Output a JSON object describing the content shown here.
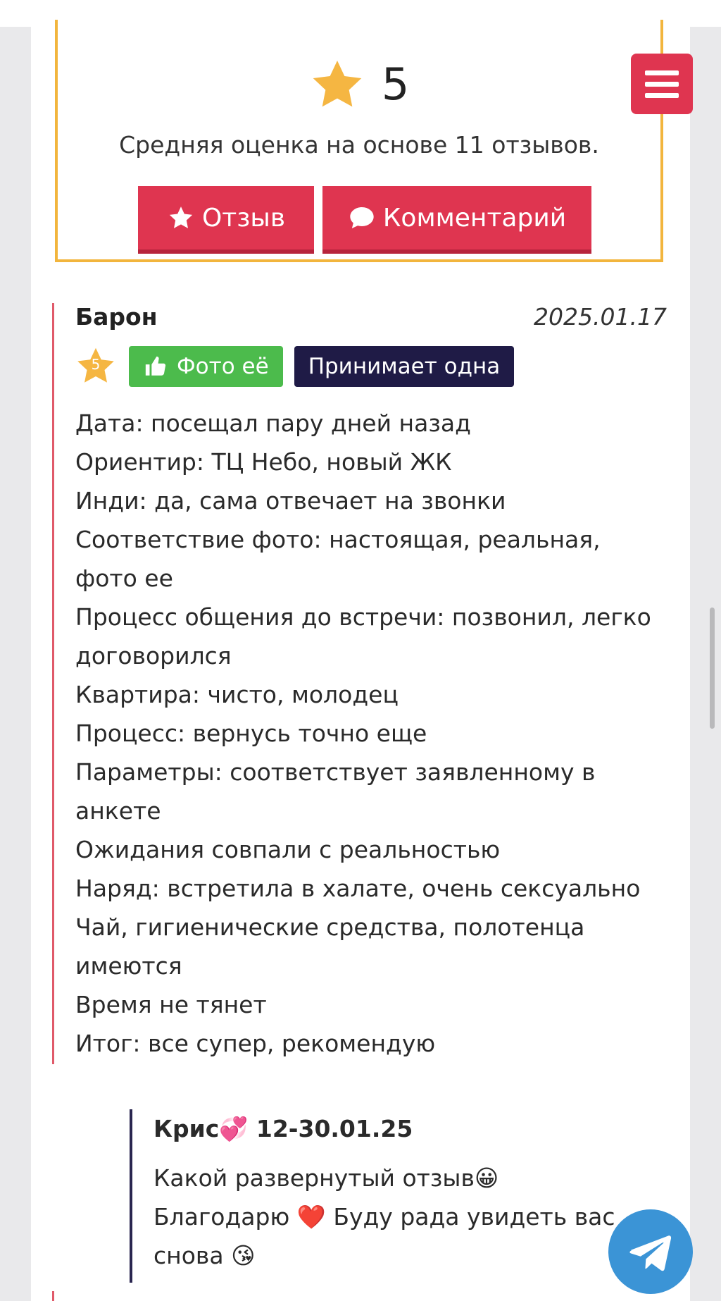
{
  "rating": {
    "value": "5",
    "summary": "Средняя оценка на основе 11 отзывов.",
    "review_button": "Отзыв",
    "comment_button": "Комментарий"
  },
  "review": {
    "author": "Барон",
    "date": "2025.01.17",
    "stars": "5",
    "tag_photo": "Фото её",
    "tag_accepts": "Принимает одна",
    "lines": [
      "Дата: посещал пару дней назад",
      "Ориентир: ТЦ Небо, новый ЖК",
      "Инди: да, сама отвечает на звонки",
      "Соответствие фото: настоящая, реальная, фото ее",
      "Процесс общения до встречи: позвонил, легко договорился",
      "Квартира: чисто, молодец",
      "Процесс: вернусь точно еще",
      "Параметры: соответствует заявленному в анкете",
      "Ожидания совпали с реальностью",
      "Наряд: встретила в халате, очень сексуально",
      "Чай, гигиенические средства, полотенца имеются",
      "Время не тянет",
      "Итог: все супер, рекомендую"
    ]
  },
  "reply": {
    "header": "Крис💞 12-30.01.25",
    "line1": "Какой развернутый отзыв😀",
    "line2": "Благодарю ❤️ Буду рада увидеть вас снова 😘"
  },
  "colors": {
    "accent": "#df3550",
    "rating_border": "#f2b53d",
    "photo_tag": "#4cbb4c",
    "accepts_tag": "#1f1b46",
    "telegram": "#3b94d6"
  },
  "icons": [
    "star-icon",
    "comment-icon",
    "thumbs-up-icon",
    "hamburger-icon",
    "telegram-icon"
  ]
}
